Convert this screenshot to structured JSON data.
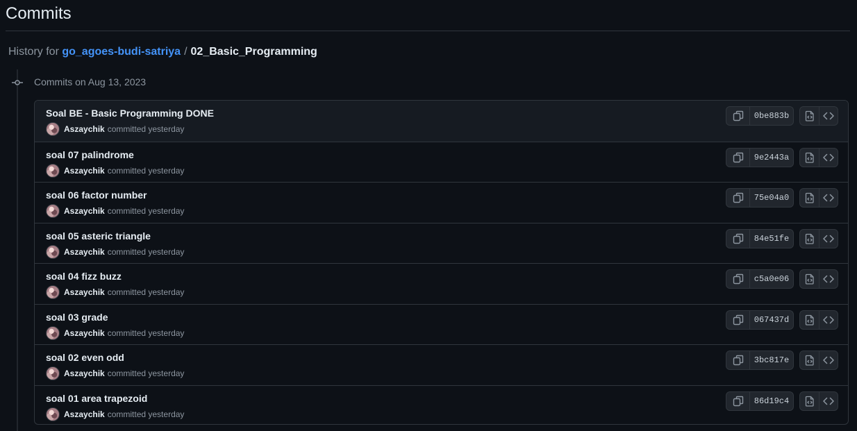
{
  "page": {
    "title": "Commits"
  },
  "breadcrumb": {
    "prefix": "History for",
    "repo": "go_agoes-budi-satriya",
    "separator": "/",
    "folder": "02_Basic_Programming"
  },
  "group": {
    "heading": "Commits on Aug 13, 2023"
  },
  "commits": [
    {
      "message": "Soal BE - Basic Programming DONE",
      "author": "Aszaychik",
      "action": "committed yesterday",
      "sha": "0be883b"
    },
    {
      "message": "soal 07 palindrome",
      "author": "Aszaychik",
      "action": "committed yesterday",
      "sha": "9e2443a"
    },
    {
      "message": "soal 06 factor number",
      "author": "Aszaychik",
      "action": "committed yesterday",
      "sha": "75e04a0"
    },
    {
      "message": "soal 05 asteric triangle",
      "author": "Aszaychik",
      "action": "committed yesterday",
      "sha": "84e51fe"
    },
    {
      "message": "soal 04 fizz buzz",
      "author": "Aszaychik",
      "action": "committed yesterday",
      "sha": "c5a0e06"
    },
    {
      "message": "soal 03 grade",
      "author": "Aszaychik",
      "action": "committed yesterday",
      "sha": "067437d"
    },
    {
      "message": "soal 02 even odd",
      "author": "Aszaychik",
      "action": "committed yesterday",
      "sha": "3bc817e"
    },
    {
      "message": "soal 01 area trapezoid",
      "author": "Aszaychik",
      "action": "committed yesterday",
      "sha": "86d19c4"
    }
  ],
  "icons": {
    "timeline": "git-commit-icon",
    "copy": "copy-icon",
    "browse_files": "file-code-icon",
    "browse_repo": "code-icon"
  },
  "colors": {
    "background": "#0d1117",
    "link": "#4493f8",
    "border": "#30363d",
    "muted": "#8d96a0"
  }
}
